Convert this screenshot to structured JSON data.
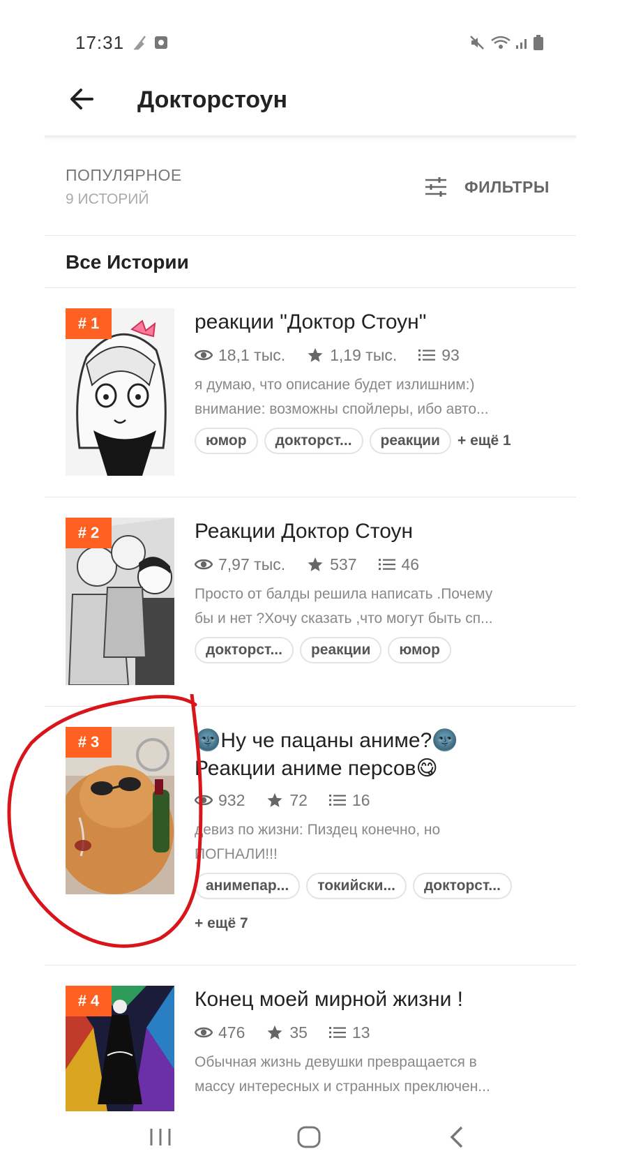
{
  "status_bar": {
    "time": "17:31",
    "left_icons": [
      "broom-icon",
      "screen-record-icon"
    ],
    "right_icons": [
      "mute-icon",
      "wifi-icon",
      "signal-icon",
      "battery-icon"
    ]
  },
  "header": {
    "title": "Докторстоун",
    "back_icon": "arrow-left-icon"
  },
  "section": {
    "sort_label": "ПОПУЛЯРНОЕ",
    "story_count": "9 ИСТОРИЙ",
    "filters_label": "ФИЛЬТРЫ",
    "filters_icon": "sliders-icon"
  },
  "list_heading": "Все Истории",
  "accent_color": "#ff6122",
  "annotation_color": "#d8151b",
  "stories": [
    {
      "rank": "# 1",
      "title": "реакции \"Доктор Стоун\"",
      "views": "18,1 тыс.",
      "votes": "1,19 тыс.",
      "parts": "93",
      "desc_line1": "я думаю, что описание будет излишним:)",
      "desc_line2": "внимание: возможны спойлеры, ибо авто...",
      "tags": [
        "юмор",
        "докторст...",
        "реакции"
      ],
      "more_tags": "+ ещё 1"
    },
    {
      "rank": "# 2",
      "title": "Реакции Доктор Стоун",
      "views": "7,97 тыс.",
      "votes": "537",
      "parts": "46",
      "desc_line1": "Просто от балды решила написать .Почему",
      "desc_line2": "бы и нет ?Хочу сказать ,что могут быть сп...",
      "tags": [
        "докторст...",
        "реакции",
        "юмор"
      ]
    },
    {
      "rank": "# 3",
      "title_line1": "🌚Ну че пацаны аниме?🌚",
      "title_line2": "Реакции аниме персов😋",
      "views": "932",
      "votes": "72",
      "parts": "16",
      "desc_line1": "девиз по жизни: Пиздец конечно, но",
      "desc_line2": "ПОГНАЛИ!!!",
      "tags": [
        "анимепар...",
        "токийски...",
        "докторст..."
      ],
      "more_tags": "+ ещё 7"
    },
    {
      "rank": "# 4",
      "title": "Конец моей мирной жизни !",
      "views": "476",
      "votes": "35",
      "parts": "13",
      "desc_line1": "Обычная жизнь девушки превращается в",
      "desc_line2": "массу интересных и странных преключен..."
    }
  ],
  "nav_bar": {
    "icons": [
      "recent-apps-icon",
      "home-icon",
      "back-icon"
    ]
  }
}
